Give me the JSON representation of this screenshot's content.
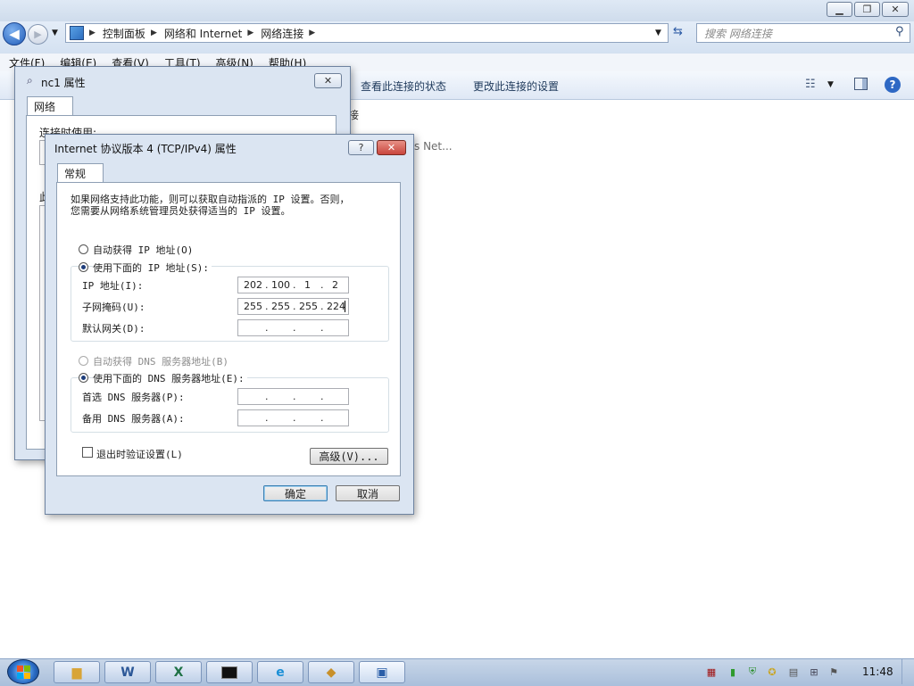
{
  "explorer": {
    "breadcrumb": [
      "控制面板",
      "网络和 Internet",
      "网络连接"
    ],
    "search_placeholder": "搜索 网络连接",
    "menu": [
      "文件(F)",
      "编辑(E)",
      "查看(V)",
      "工具(T)",
      "高级(N)",
      "帮助(H)"
    ],
    "commands": [
      "查看此连接的状态",
      "更改此连接的设置"
    ],
    "item_fragment_1": "s Net...",
    "item_fragment_2": "接"
  },
  "nc1_dialog": {
    "title": "nc1 属性",
    "tab": "网络",
    "label_connect": "连接时使用:",
    "label_frag": "此"
  },
  "ipv4_dialog": {
    "title": "Internet 协议版本 4 (TCP/IPv4) 属性",
    "help_btn": "?",
    "close_btn": "✕",
    "tab": "常规",
    "description_line1": "如果网络支持此功能，则可以获取自动指派的 IP 设置。否则，",
    "description_line2": "您需要从网络系统管理员处获得适当的 IP 设置。",
    "radio_auto_ip": "自动获得 IP 地址(O)",
    "radio_manual_ip": "使用下面的 IP 地址(S):",
    "ip_label": "IP 地址(I):",
    "ip_address": [
      "202",
      "100",
      "1",
      "2"
    ],
    "mask_label": "子网掩码(U):",
    "subnet_mask": [
      "255",
      "255",
      "255",
      "224"
    ],
    "gateway_label": "默认网关(D):",
    "radio_auto_dns": "自动获得 DNS 服务器地址(B)",
    "radio_manual_dns": "使用下面的 DNS 服务器地址(E):",
    "dns1_label": "首选 DNS 服务器(P):",
    "dns2_label": "备用 DNS 服务器(A):",
    "validate_label": "退出时验证设置(L)",
    "advanced_btn": "高级(V)...",
    "ok_btn": "确定",
    "cancel_btn": "取消",
    "dot": "."
  },
  "taskbar": {
    "clock": "11:48"
  },
  "colors": {
    "accent": "#1e3d7b",
    "close_red": "#c9463d"
  }
}
